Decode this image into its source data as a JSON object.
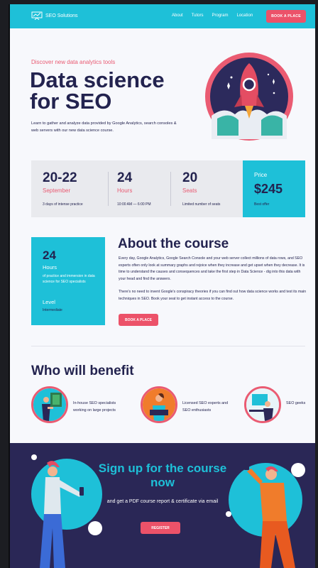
{
  "nav": {
    "logo_text": "SEO Solutions",
    "links": [
      "About",
      "Tutors",
      "Program",
      "Location"
    ],
    "cta": "BOOK A PLACE"
  },
  "hero": {
    "eyebrow": "Discover new data analytics tools",
    "title": "Data science for SEO",
    "description": "Learn to gather and analyze data provided by Google Analytics, search consoles & web servers with our new data science course."
  },
  "stats": [
    {
      "value": "20-22",
      "unit": "September",
      "note": "3 days of intense practice"
    },
    {
      "value": "24",
      "unit": "Hours",
      "note": "10:00 AM — 6:00 PM"
    },
    {
      "value": "20",
      "unit": "Seats",
      "note": "Limited number of seats"
    }
  ],
  "price": {
    "label": "Price",
    "value": "$245",
    "note": "Best offer"
  },
  "about_card": {
    "value": "24",
    "unit": "Hours",
    "description": "of practice and immersion in data science for SEO specialists",
    "level_label": "Level",
    "level_value": "Intermediate"
  },
  "about": {
    "title": "About the course",
    "paragraph1": "Every day, Google Analytics, Google Search Console and your web server collect millions of data rows, and SEO experts often only look at summary graphs and rejoice when they increase and get upset when they decrease. It is time to understand the causes and consequences and take the first step in Data Science - dig into this data with your head and find the answers.",
    "paragraph2": "There's no need to invent Google's conspiracy theories if you can find out how data science works and test its main techniques in SEO. Book your seat to get instant access to the course.",
    "button": "BOOK A PLACE"
  },
  "benefit": {
    "title": "Who will benefit",
    "items": [
      {
        "label": "In-house SEO specialists working on large projects"
      },
      {
        "label": "Licensed SEO experts and SEO enthusiasts"
      },
      {
        "label": "SEO geeks"
      }
    ]
  },
  "signup": {
    "title": "Sign up for the course now",
    "description": "and get a PDF course report & certificate via email",
    "button": "REGISTER"
  },
  "colors": {
    "accent": "#1ec0d8",
    "brand_pink": "#ec5269",
    "navy": "#23234f",
    "signup_bg": "#2a2756"
  }
}
